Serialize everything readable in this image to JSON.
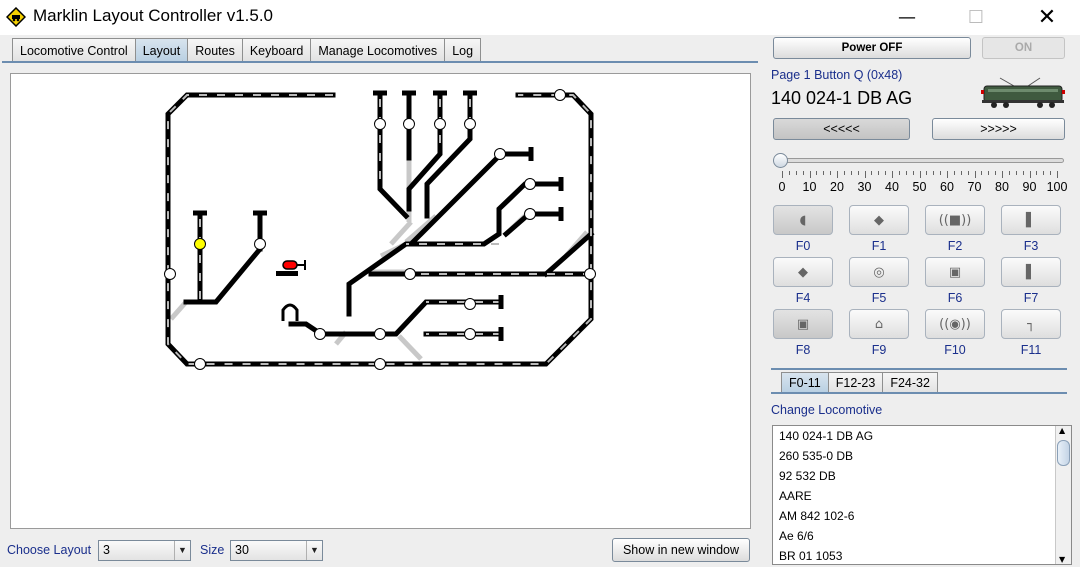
{
  "window": {
    "title": "Marklin Layout Controller v1.5.0"
  },
  "tabs": [
    "Locomotive Control",
    "Layout",
    "Routes",
    "Keyboard",
    "Manage Locomotives",
    "Log"
  ],
  "active_tab": "Layout",
  "bottom": {
    "choose_layout_label": "Choose Layout",
    "layout_value": "3",
    "size_label": "Size",
    "size_value": "30",
    "show_window_label": "Show in new window"
  },
  "power": {
    "off_label": "Power OFF",
    "on_label": "ON"
  },
  "locomotive": {
    "page_label": "Page 1 Button Q  (0x48)",
    "name": "140 024-1 DB AG"
  },
  "direction": {
    "reverse_label": "<<<<<",
    "forward_label": ">>>>>"
  },
  "speed": {
    "value": 0,
    "tick_labels": [
      "0",
      "10",
      "20",
      "30",
      "40",
      "50",
      "60",
      "70",
      "80",
      "90",
      "100"
    ]
  },
  "functions": [
    {
      "label": "F0",
      "icon": "headlight-icon",
      "on": true
    },
    {
      "label": "F1",
      "icon": "coupler-icon",
      "on": false
    },
    {
      "label": "F2",
      "icon": "horn-icon",
      "on": false
    },
    {
      "label": "F3",
      "icon": "pantograph-icon",
      "on": false
    },
    {
      "label": "F4",
      "icon": "coupler-icon",
      "on": false
    },
    {
      "label": "F5",
      "icon": "bell-icon",
      "on": false
    },
    {
      "label": "F6",
      "icon": "cab-icon",
      "on": false
    },
    {
      "label": "F7",
      "icon": "pantograph-icon",
      "on": false
    },
    {
      "label": "F8",
      "icon": "locomotive-icon",
      "on": true
    },
    {
      "label": "F9",
      "icon": "compressor-icon",
      "on": false
    },
    {
      "label": "F10",
      "icon": "sound-icon",
      "on": false
    },
    {
      "label": "F11",
      "icon": "pipe-icon",
      "on": false
    }
  ],
  "function_tabs": [
    "F0-11",
    "F12-23",
    "F24-32"
  ],
  "change_locomotive_label": "Change Locomotive",
  "locomotive_list": [
    "140 024-1 DB AG",
    "260 535-0 DB",
    "92 532 DB",
    "AARE",
    "AM 842 102-6",
    "Ae 6/6",
    "BR 01 1053"
  ],
  "colors": {
    "accent_blue": "#1a2f8c",
    "track": "#000000",
    "occupied": "#ffff00",
    "signal_red": "#ff0000"
  }
}
